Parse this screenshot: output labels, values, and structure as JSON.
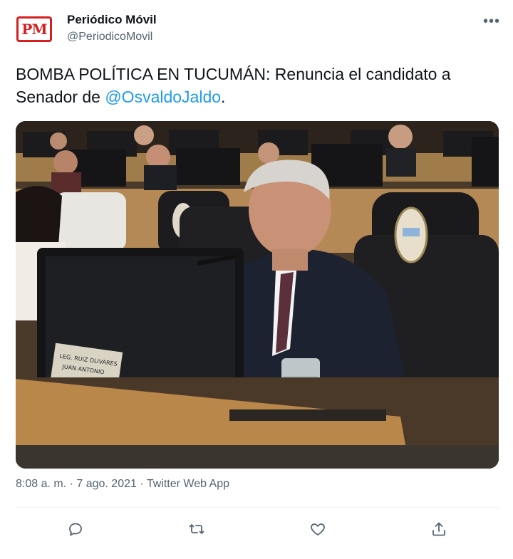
{
  "account": {
    "avatar_text": "PM",
    "name": "Periódico Móvil",
    "handle": "@PeriodicoMovil"
  },
  "tweet": {
    "text_before": "BOMBA POLÍTICA EN TUCUMÁN: Renuncia el candidato a Senador de ",
    "mention": "@OsvaldoJaldo",
    "text_after": ".",
    "timestamp": "8:08 a. m. · 7 ago. 2021 · Twitter Web App"
  },
  "photo": {
    "nameplate_line1": "LEG. RUIZ OLIVARES",
    "nameplate_line2": "JUAN ANTONIO"
  },
  "icons": {
    "more": "more-options-icon",
    "reply": "reply-icon",
    "retweet": "retweet-icon",
    "like": "heart-icon",
    "share": "share-icon"
  },
  "colors": {
    "accent": "#1d9bf0",
    "secondary_text": "#536471",
    "brand_red": "#d61f1f"
  }
}
